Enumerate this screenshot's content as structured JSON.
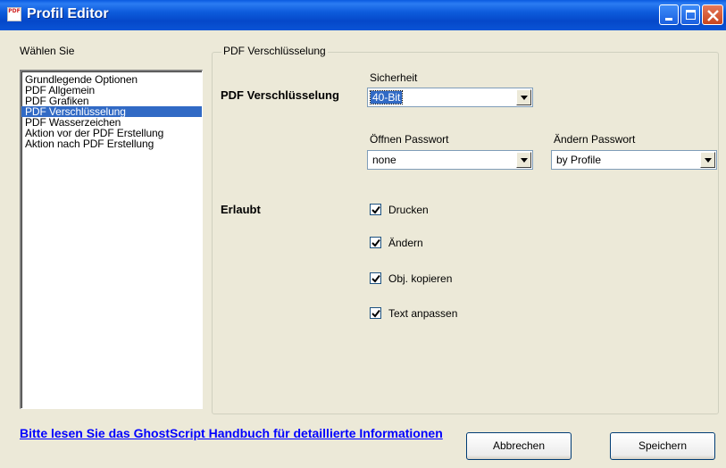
{
  "window": {
    "title": "Profil Editor",
    "app_icon_text": "PDF"
  },
  "sidebar": {
    "label": "Wählen Sie",
    "items": [
      {
        "label": "Grundlegende Optionen"
      },
      {
        "label": "PDF Allgemein"
      },
      {
        "label": "PDF Grafiken"
      },
      {
        "label": "PDF Verschlüsselung"
      },
      {
        "label": "PDF Wasserzeichen"
      },
      {
        "label": "Aktion vor der PDF Erstellung"
      },
      {
        "label": "Aktion nach PDF Erstellung"
      }
    ],
    "selected_index": 3
  },
  "group": {
    "title": "PDF Verschlüsselung",
    "encryption_label": "PDF Verschlüsselung",
    "security": {
      "label": "Sicherheit",
      "value": "40-Bit"
    },
    "open_password": {
      "label": "Öffnen Passwort",
      "value": "none"
    },
    "change_password": {
      "label": "Ändern Passwort",
      "value": "by Profile"
    },
    "allowed_label": "Erlaubt",
    "permissions": [
      {
        "label": "Drucken",
        "checked": true
      },
      {
        "label": "Ändern",
        "checked": true
      },
      {
        "label": "Obj. kopieren",
        "checked": true
      },
      {
        "label": "Text anpassen",
        "checked": true
      }
    ]
  },
  "footer": {
    "link_text": "Bitte lesen Sie das GhostScript Handbuch für detaillierte Informationen",
    "cancel_label": "Abbrechen",
    "save_label": "Speichern"
  }
}
